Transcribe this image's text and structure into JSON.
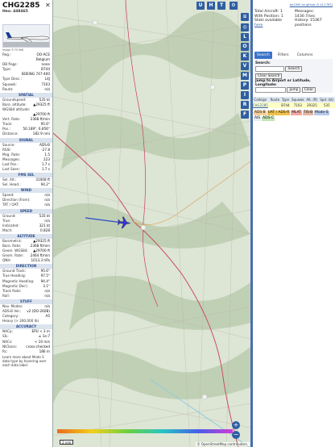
{
  "aircraft": {
    "callsign": "CHG2285",
    "hex_label": "Hex: 448465",
    "photo_caption": "Image © FS 996",
    "fields": [
      {
        "k": "Reg.:",
        "v": "OO-ACE"
      },
      {
        "k": "",
        "v": "Belgium"
      },
      {
        "k": "DB flags:",
        "v": "none"
      },
      {
        "k": "Type:",
        "v": "B744"
      },
      {
        "k": "",
        "v": "BOEING 747-400"
      },
      {
        "k": "Type Desc.:",
        "v": "L4J"
      },
      {
        "k": "Squawk:",
        "v": "7103"
      },
      {
        "k": "Route:",
        "v": "n/a"
      }
    ]
  },
  "sections": [
    {
      "title": "SPATIAL",
      "rows": [
        {
          "k": "Groundspeed:",
          "v": "535 kt"
        },
        {
          "k": "Baro. altitude:",
          "v": "▲29325 ft"
        },
        {
          "k": "WGS84 altitude:",
          "v": ""
        },
        {
          "k": "",
          "v": "▲29700 ft"
        },
        {
          "k": "Vert. Rate:",
          "v": "2368 ft/min"
        },
        {
          "k": "Track:",
          "v": "95.6°"
        },
        {
          "k": "Pos.:",
          "v": "50.189°, 6.856°"
        },
        {
          "k": "Distance:",
          "v": "182.9 nmi"
        }
      ]
    },
    {
      "title": "SIGNAL",
      "rows": [
        {
          "k": "Source:",
          "v": "ADS-B"
        },
        {
          "k": "RSSI:",
          "v": "-27.8"
        },
        {
          "k": "Msg. Rate:",
          "v": "1.5"
        },
        {
          "k": "Messages:",
          "v": "223"
        },
        {
          "k": "Last Pos.:",
          "v": "1.7 s"
        },
        {
          "k": "Last Seen:",
          "v": "1.7 s"
        }
      ]
    },
    {
      "title": "FMS SEL",
      "rows": [
        {
          "k": "Sel. Alt.:",
          "v": "31008 ft"
        },
        {
          "k": "Sel. Head.:",
          "v": "94.2°"
        }
      ]
    },
    {
      "title": "WIND",
      "rows": [
        {
          "k": "Speed:",
          "v": "n/a"
        },
        {
          "k": "Direction (from):",
          "v": "n/a"
        },
        {
          "k": "TAT / OAT:",
          "v": "n/a"
        }
      ]
    },
    {
      "title": "SPEED",
      "rows": [
        {
          "k": "Ground:",
          "v": "535 kt"
        },
        {
          "k": "True:",
          "v": "n/a"
        },
        {
          "k": "Indicated:",
          "v": "321 kt"
        },
        {
          "k": "Mach:",
          "v": "0.828"
        }
      ]
    },
    {
      "title": "ALTITUDE",
      "rows": [
        {
          "k": "Barometric:",
          "v": "▲29325 ft"
        },
        {
          "k": "Baro. Rate:",
          "v": "2368 ft/min"
        },
        {
          "k": "Geom. WGS84:",
          "v": "▲29700 ft"
        },
        {
          "k": "Geom. Rate:",
          "v": "2464 ft/min"
        },
        {
          "k": "QNH:",
          "v": "1013.3 hPa"
        }
      ]
    },
    {
      "title": "DIRECTION",
      "rows": [
        {
          "k": "Ground Track:",
          "v": "95.6°"
        },
        {
          "k": "True Heading:",
          "v": "97.5°"
        },
        {
          "k": "Magnetic Heading:",
          "v": "94.4°"
        },
        {
          "k": "Magnetic Decl.:",
          "v": "3.1°"
        },
        {
          "k": "Track Rate:",
          "v": "n/a"
        },
        {
          "k": "Roll:",
          "v": "n/a"
        }
      ]
    },
    {
      "title": "STUFF",
      "rows": [
        {
          "k": "Nav. Modes:",
          "v": "n/a"
        },
        {
          "k": "ADS-B Ver.:",
          "v": "v2 (DO-260B)"
        },
        {
          "k": "Category:",
          "v": "A5"
        },
        {
          "k": "Heavy (> 300,000 lb)",
          "v": ""
        }
      ]
    },
    {
      "title": "ACCURACY",
      "rows": [
        {
          "k": "NACp:",
          "v": "EPU < 3 m"
        },
        {
          "k": "SIL:",
          "v": "≤ 1e-7"
        },
        {
          "k": "NACv:",
          "v": "< 10 m/s"
        },
        {
          "k": "NICbaro:",
          "v": "cross-checked"
        },
        {
          "k": "Rc:",
          "v": "186 m"
        }
      ]
    }
  ],
  "legend_link": "Learn more about Mode S data type by hovering over each data label.",
  "map": {
    "top_buttons": [
      "U",
      "H",
      "T"
    ],
    "side_buttons": [
      "L",
      "O",
      "K",
      "V",
      "M",
      "P",
      "I",
      "R",
      "F"
    ],
    "scale": "2 nmi",
    "attribution": "© OpenStreetMap contributors.",
    "zoom_in": "+",
    "zoom_out": "−",
    "altitude_scale": "2000 ... 40000+"
  },
  "stats": {
    "github": "tar1090 on github (3.14.1763)",
    "total_aircraft": "Total Aircraft: 1",
    "with_position": "With Position: 1",
    "stats_available": "Stats available",
    "here": "here",
    "messages": "Messages: 1430.7/sec",
    "history": "History: 15367 positions"
  },
  "tabs": [
    "Search",
    "Filters",
    "Columns"
  ],
  "search": {
    "label": "Search:",
    "button": "Search",
    "clear": "Clear Search",
    "jump_label": "Jump to Airport or Latitude, Longitude:",
    "jump_button": "Jump",
    "clear_small": "Clear"
  },
  "table": {
    "headers": [
      "Callsign",
      "Route",
      "Type",
      "Squawk",
      "Alt. (ft)",
      "Spd. (kt)"
    ],
    "rows": [
      [
        "CHG2285",
        "",
        "B744",
        "7103",
        "29325",
        "535"
      ]
    ]
  },
  "badges": [
    {
      "text": "ADS-B",
      "color": "#f4d09a"
    },
    {
      "text": "UAT / ADS-R",
      "color": "#f0c24d"
    },
    {
      "text": "MLAT",
      "color": "#f3a8a2"
    },
    {
      "text": "TIS-B",
      "color": "#e4b6a0"
    },
    {
      "text": "Mode-S",
      "color": "#b8c8e8"
    },
    {
      "text": "AIS",
      "color": "#e6ecf5"
    },
    {
      "text": "ADS-C",
      "color": "#c5e5b6"
    }
  ],
  "colors": {
    "accent": "#2f5fa2",
    "aircraft_icon": "#3336cc",
    "track_line": "#2b49c9"
  }
}
